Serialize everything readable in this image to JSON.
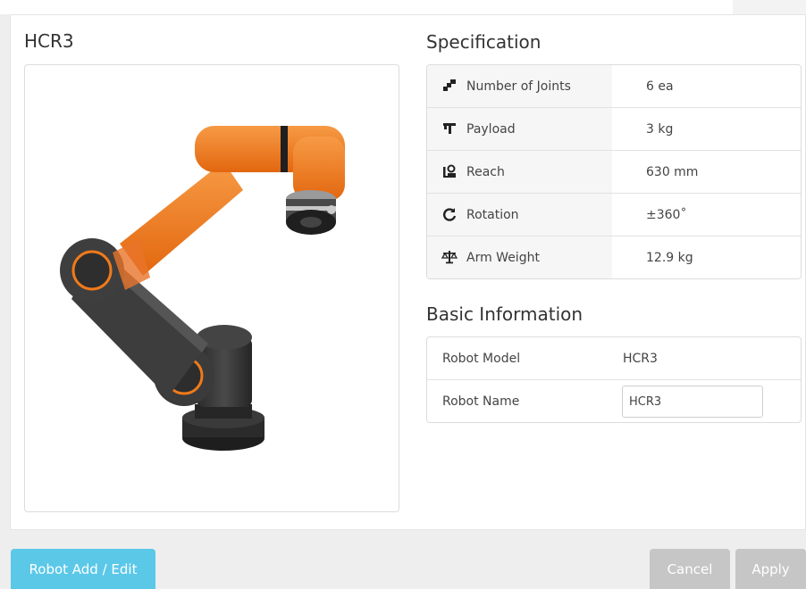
{
  "robot": {
    "title": "HCR3",
    "image_icon": "robot-arm-image",
    "colors": {
      "orange": "#f07a1a",
      "dark": "#3a3a3a"
    }
  },
  "specification": {
    "title": "Specification",
    "rows": [
      {
        "icon": "joints-icon",
        "label": "Number of Joints",
        "value": "6 ea"
      },
      {
        "icon": "payload-icon",
        "label": "Payload",
        "value": "3 kg"
      },
      {
        "icon": "reach-icon",
        "label": "Reach",
        "value": "630 mm"
      },
      {
        "icon": "rotation-icon",
        "label": "Rotation",
        "value": "±360˚"
      },
      {
        "icon": "scale-icon",
        "label": "Arm Weight",
        "value": "12.9 kg"
      }
    ]
  },
  "basic_information": {
    "title": "Basic Information",
    "model_label": "Robot Model",
    "model_value": "HCR3",
    "name_label": "Robot Name",
    "name_value": "HCR3"
  },
  "footer": {
    "add_edit_label": "Robot Add / Edit",
    "cancel_label": "Cancel",
    "apply_label": "Apply",
    "colors": {
      "primary": "#5bc8e8",
      "disabled": "#c6c6c6"
    }
  }
}
